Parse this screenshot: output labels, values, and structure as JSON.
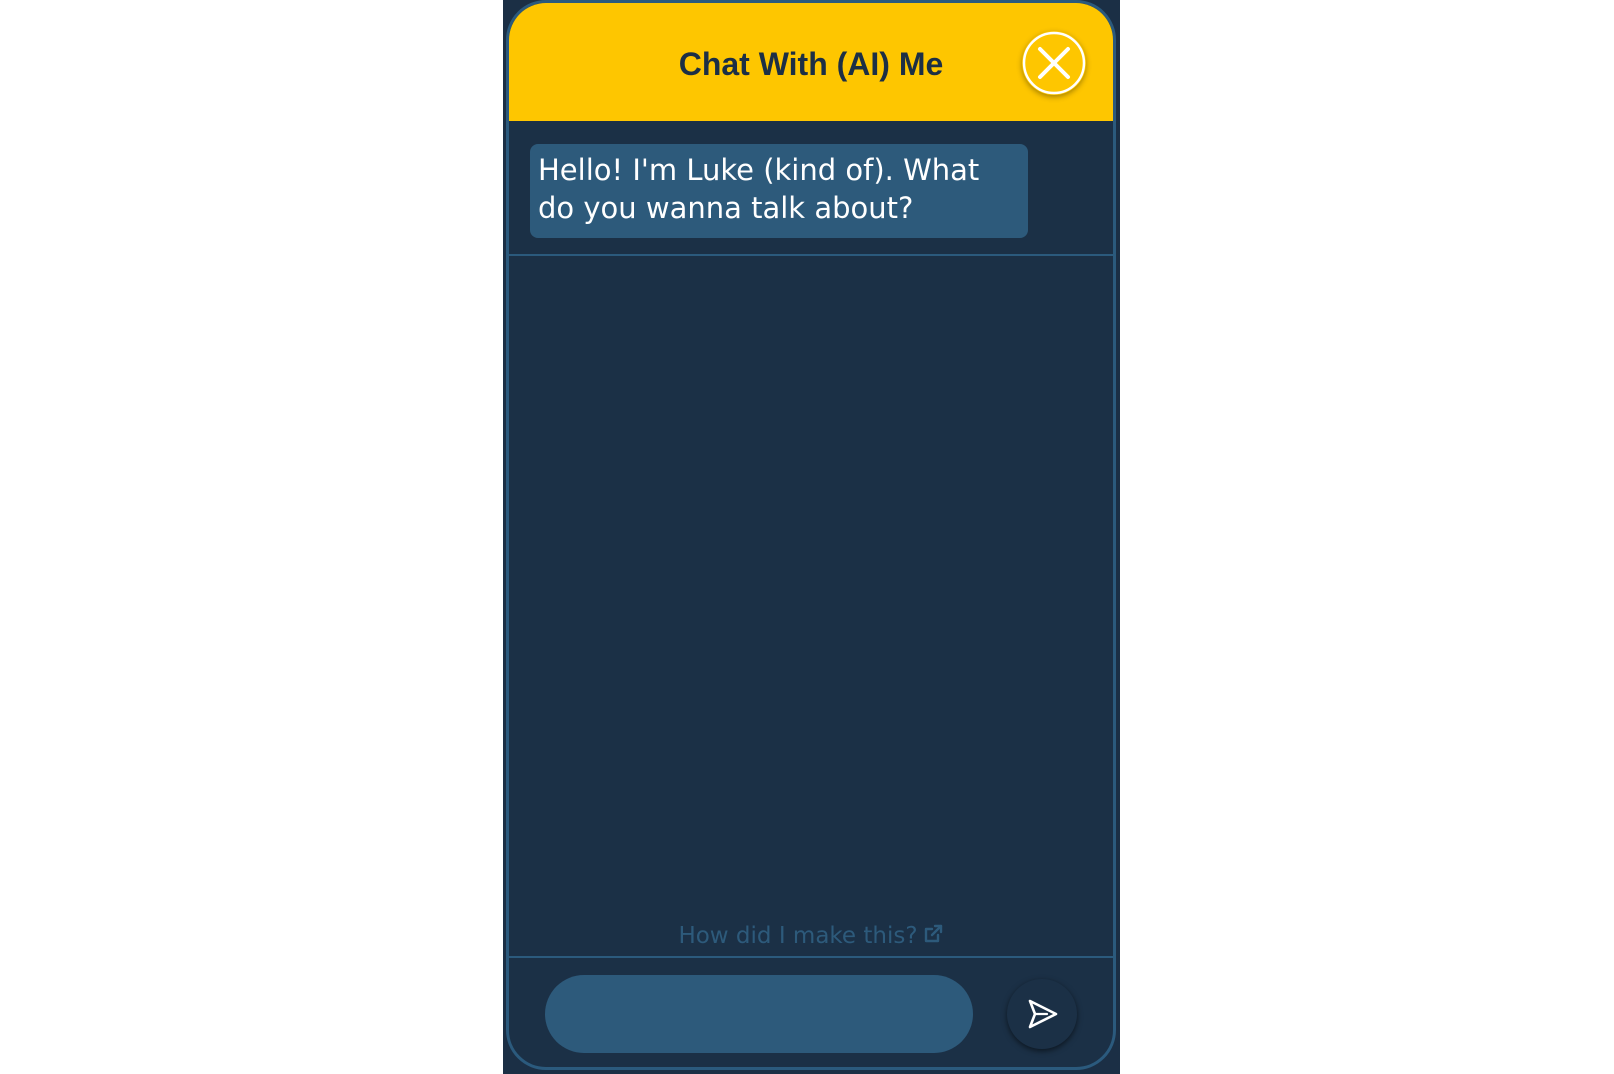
{
  "header": {
    "title": "Chat With (AI) Me",
    "close_icon": "close-icon"
  },
  "messages": [
    {
      "sender": "bot",
      "text": "Hello! I'm Luke (kind of). What do you wanna talk about?"
    }
  ],
  "footer": {
    "link_text": "How did I make this?",
    "link_icon": "external-link-icon",
    "input_value": "",
    "send_icon": "send-icon"
  },
  "colors": {
    "header": "#fec600",
    "background": "#1b3046",
    "bubble": "#2d5a7b",
    "border": "#2b5a7d",
    "title_text": "#1c2f45"
  }
}
